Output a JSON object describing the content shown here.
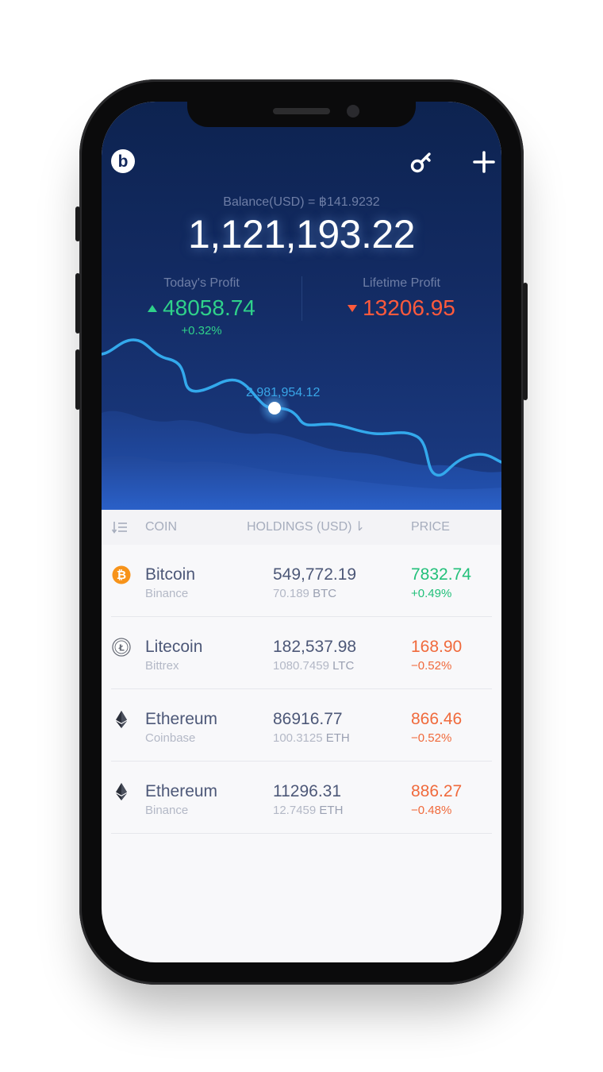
{
  "header": {
    "logo_letter": "b",
    "icons": [
      "key-icon",
      "plus-icon"
    ]
  },
  "balance": {
    "label": "Balance(USD) = ฿141.9232",
    "value": "1,121,193.22"
  },
  "profit": {
    "today_label": "Today's Profit",
    "today_value": "48058.74",
    "today_pct": "+0.32%",
    "lifetime_label": "Lifetime Profit",
    "lifetime_value": "13206.95"
  },
  "chart": {
    "tooltip": "2,981,954.12",
    "colors": {
      "line": "#33a9ec",
      "marker": "#ffffff"
    }
  },
  "table": {
    "col_coin": "COIN",
    "col_holdings": "HOLDINGS (USD)",
    "col_price": "PRICE",
    "rows": [
      {
        "name": "Bitcoin",
        "exchange": "Binance",
        "holdings": "549,772.19",
        "amount": "70.189",
        "unit": "BTC",
        "price": "7832.74",
        "change": "+0.49%",
        "direction": "up",
        "icon": "bitcoin-icon"
      },
      {
        "name": "Litecoin",
        "exchange": "Bittrex",
        "holdings": "182,537.98",
        "amount": "1080.7459",
        "unit": "LTC",
        "price": "168.90",
        "change": "−0.52%",
        "direction": "down",
        "icon": "litecoin-icon"
      },
      {
        "name": "Ethereum",
        "exchange": "Coinbase",
        "holdings": "86916.77",
        "amount": "100.3125",
        "unit": "ETH",
        "price": "866.46",
        "change": "−0.52%",
        "direction": "down",
        "icon": "ethereum-icon"
      },
      {
        "name": "Ethereum",
        "exchange": "Binance",
        "holdings": "11296.31",
        "amount": "12.7459",
        "unit": "ETH",
        "price": "886.27",
        "change": "−0.48%",
        "direction": "down",
        "icon": "ethereum-icon"
      }
    ]
  },
  "colors": {
    "positive": "#22c07a",
    "negative": "#f06a3c",
    "header_bg": "#132b63"
  }
}
